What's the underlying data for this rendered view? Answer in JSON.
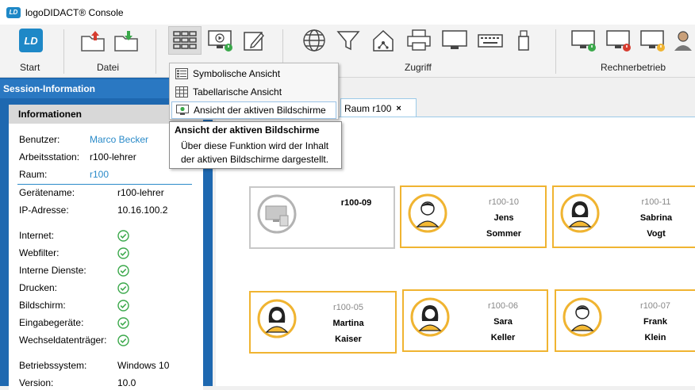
{
  "window": {
    "title": "logoDIDACT® Console"
  },
  "ribbon": {
    "groups": [
      {
        "label": "Start"
      },
      {
        "label": "Datei"
      },
      {
        "label": "Zugriff"
      },
      {
        "label": "Rechnerbetrieb"
      }
    ]
  },
  "view_menu": {
    "items": [
      {
        "label": "Symbolische Ansicht"
      },
      {
        "label": "Tabellarische Ansicht"
      },
      {
        "label": "Ansicht der aktiven Bildschirme"
      }
    ]
  },
  "tooltip": {
    "title": "Ansicht der aktiven Bildschirme",
    "body": "Über diese Funktion wird der Inhalt der aktiven Bildschirme dargestellt."
  },
  "session": {
    "header": "Session-Information",
    "info_title": "Informationen",
    "fields": {
      "user_label": "Benutzer:",
      "user_value": "Marco Becker",
      "ws_label": "Arbeitsstation:",
      "ws_value": "r100-lehrer",
      "room_label": "Raum:",
      "room_value": "r100",
      "device_label": "Gerätename:",
      "device_value": "r100-lehrer",
      "ip_label": "IP-Adresse:",
      "ip_value": "10.16.100.2",
      "os_label": "Betriebssystem:",
      "os_value": "Windows 10",
      "version_label": "Version:",
      "version_value": "10.0"
    },
    "services": [
      {
        "label": "Internet:"
      },
      {
        "label": "Webfilter:"
      },
      {
        "label": "Interne Dienste:"
      },
      {
        "label": "Drucken:"
      },
      {
        "label": "Bildschirm:"
      },
      {
        "label": "Eingabegeräte:"
      },
      {
        "label": "Wechseldatenträger:"
      }
    ]
  },
  "tab": {
    "label": "Raum r100",
    "close": "×"
  },
  "workstations": [
    {
      "ws": "r100-09",
      "first": "",
      "last": ""
    },
    {
      "ws": "r100-10",
      "first": "Jens",
      "last": "Sommer"
    },
    {
      "ws": "r100-11",
      "first": "Sabrina",
      "last": "Vogt"
    },
    {
      "ws": "r100-05",
      "first": "Martina",
      "last": "Kaiser"
    },
    {
      "ws": "r100-06",
      "first": "Sara",
      "last": "Keller"
    },
    {
      "ws": "r100-07",
      "first": "Frank",
      "last": "Klein"
    }
  ],
  "colors": {
    "accent": "#1e68b0",
    "card_border": "#f0b431",
    "avatar_fill": "#f4b934",
    "check": "#3aa84a"
  }
}
